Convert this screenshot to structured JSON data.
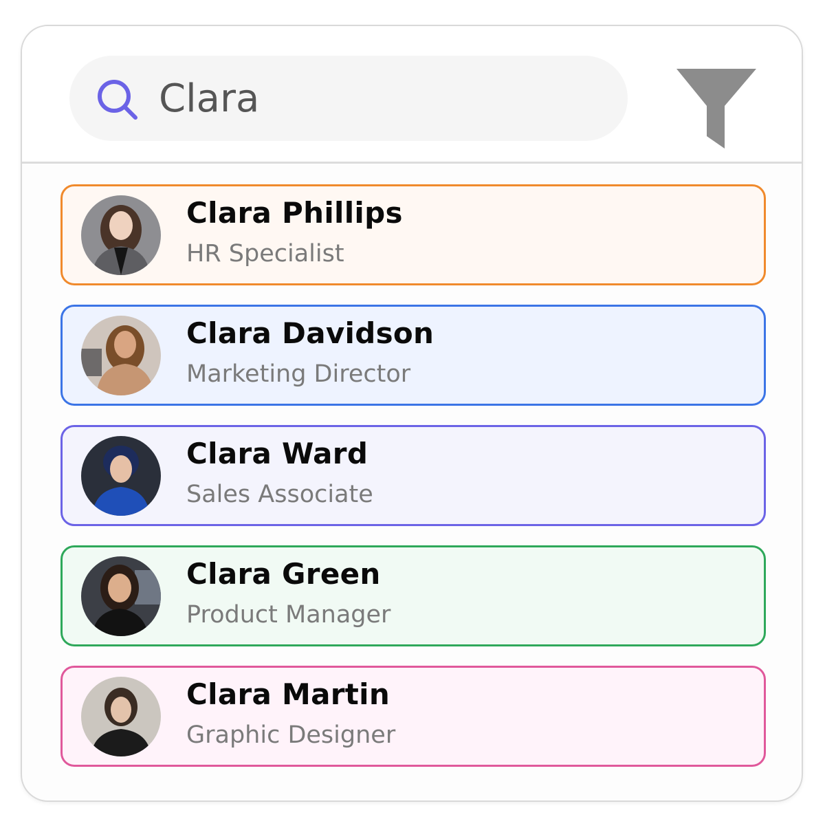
{
  "search": {
    "value": "Clara",
    "icon": "search-icon",
    "icon_color": "#6b63e6"
  },
  "filter": {
    "icon": "filter-funnel-icon",
    "color": "#8c8c8c"
  },
  "results": [
    {
      "name": "Clara Phillips",
      "role": "HR Specialist",
      "border_color": "#f08a2c",
      "bg_color": "#fff8f3"
    },
    {
      "name": "Clara Davidson",
      "role": "Marketing Director",
      "border_color": "#3b74e6",
      "bg_color": "#eef3ff"
    },
    {
      "name": "Clara Ward",
      "role": "Sales Associate",
      "border_color": "#6b63e6",
      "bg_color": "#f4f4fd"
    },
    {
      "name": "Clara Green",
      "role": "Product Manager",
      "border_color": "#2ea85a",
      "bg_color": "#f1faf4"
    },
    {
      "name": "Clara Martin",
      "role": "Graphic Designer",
      "border_color": "#e0589b",
      "bg_color": "#fff3fa"
    }
  ]
}
